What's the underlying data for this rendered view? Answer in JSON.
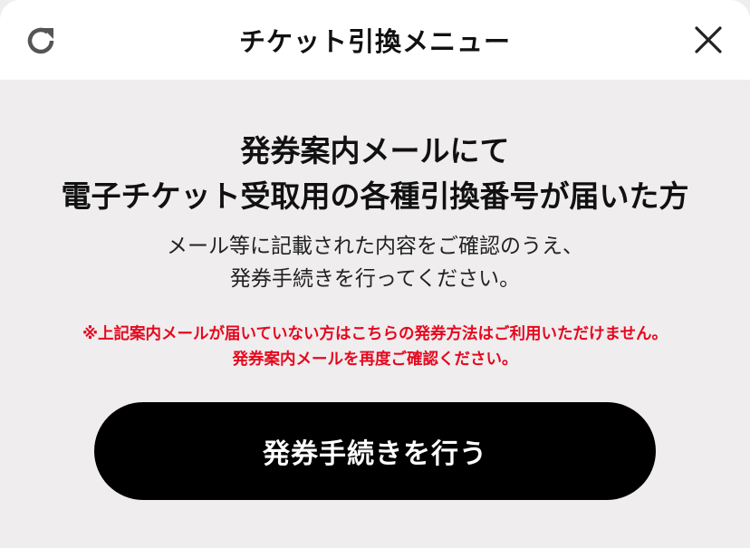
{
  "header": {
    "title": "チケット引換メニュー",
    "reload_icon": "reload-icon",
    "close_icon": "close-icon"
  },
  "main": {
    "headline_line1": "発券案内メールにて",
    "headline_line2": "電子チケット受取用の各種引換番号が届いた方",
    "instruction_line1": "メール等に記載された内容をご確認のうえ、",
    "instruction_line2": "発券手続きを行ってください。",
    "warning_line1": "※上記案内メールが届いていない方はこちらの発券方法はご利用いただけません。",
    "warning_line2": "発券案内メールを再度ご確認ください。",
    "cta_label": "発券手続きを行う"
  },
  "colors": {
    "background": "#efedee",
    "header_background": "#ffffff",
    "warning": "#e5091f",
    "button": "#000000",
    "button_text": "#ffffff"
  }
}
